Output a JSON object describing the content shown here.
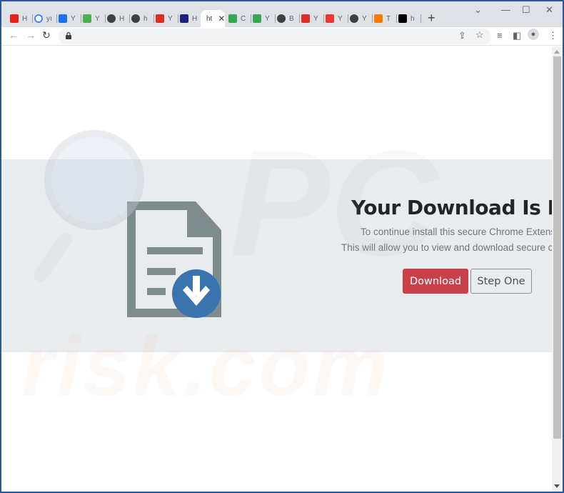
{
  "browser": {
    "tabs": [
      {
        "label": "H",
        "icon": "youtube-icon",
        "color": "#e62117"
      },
      {
        "label": "yı",
        "icon": "google-icon",
        "color": "#4285f4"
      },
      {
        "label": "Y",
        "icon": "cloud-download-icon",
        "color": "#1a73e8"
      },
      {
        "label": "Y",
        "icon": "green-download-icon",
        "color": "#4caf50"
      },
      {
        "label": "H",
        "icon": "globe-icon",
        "color": "#3c4043"
      },
      {
        "label": "h",
        "icon": "globe-icon",
        "color": "#3c4043"
      },
      {
        "label": "Y",
        "icon": "soundwave-icon",
        "color": "#d93025"
      },
      {
        "label": "H",
        "icon": "tv-icon",
        "color": "#1a237e"
      },
      {
        "label": "ht",
        "icon": "",
        "color": "",
        "active": true
      },
      {
        "label": "C",
        "icon": "green-cloud-icon",
        "color": "#34a853"
      },
      {
        "label": "Y",
        "icon": "play-icon",
        "color": "#34a853"
      },
      {
        "label": "B",
        "icon": "globe-icon",
        "color": "#3c4043"
      },
      {
        "label": "Y",
        "icon": "red-download-icon",
        "color": "#d93025"
      },
      {
        "label": "Y",
        "icon": "4k-icon",
        "color": "#e53935"
      },
      {
        "label": "Y",
        "icon": "globe-icon",
        "color": "#3c4043"
      },
      {
        "label": "T",
        "icon": "orange-wave-icon",
        "color": "#f57c00"
      },
      {
        "label": "h",
        "icon": "ch-icon",
        "color": "#000000"
      }
    ],
    "close_tab": "✕",
    "new_tab": "+",
    "address": ""
  },
  "page": {
    "headline": "Your Download Is Ready",
    "lead1": "To continue install this secure Chrome Extension",
    "lead2": "This will allow you to view and download secure content",
    "download_button": "Download",
    "step_button": "Step One"
  },
  "watermark": {
    "pc": "PC",
    "risk": "risk.com"
  },
  "colors": {
    "download": "#c9404b",
    "hero": "#e9ecef",
    "doc_icon": "#7f8c8d",
    "arrow_circle": "#3a74ae"
  }
}
